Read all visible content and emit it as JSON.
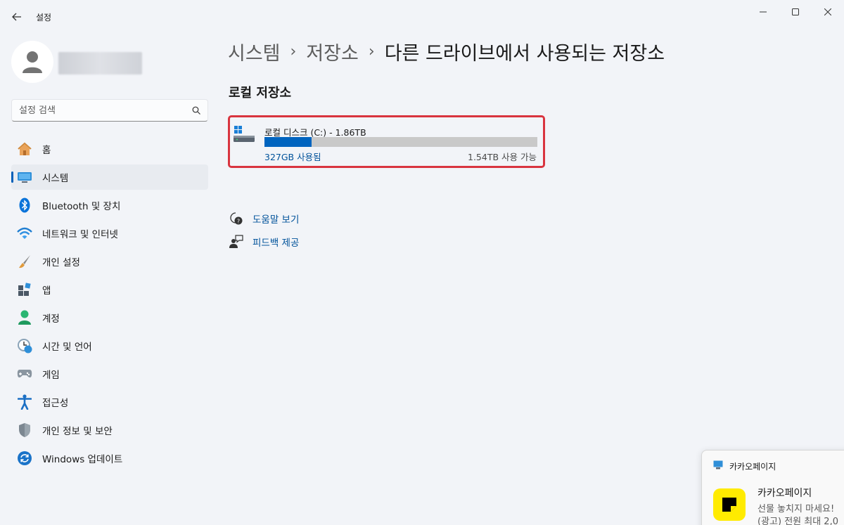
{
  "window": {
    "app_title": "설정"
  },
  "sidebar": {
    "search_placeholder": "설정 검색",
    "items": [
      {
        "label": "홈",
        "icon": "home-icon"
      },
      {
        "label": "시스템",
        "icon": "system-icon",
        "selected": true
      },
      {
        "label": "Bluetooth 및 장치",
        "icon": "bluetooth-icon"
      },
      {
        "label": "네트워크 및 인터넷",
        "icon": "wifi-icon"
      },
      {
        "label": "개인 설정",
        "icon": "brush-icon"
      },
      {
        "label": "앱",
        "icon": "apps-icon"
      },
      {
        "label": "계정",
        "icon": "account-icon"
      },
      {
        "label": "시간 및 언어",
        "icon": "time-language-icon"
      },
      {
        "label": "게임",
        "icon": "gamepad-icon"
      },
      {
        "label": "접근성",
        "icon": "accessibility-icon"
      },
      {
        "label": "개인 정보 및 보안",
        "icon": "shield-icon"
      },
      {
        "label": "Windows 업데이트",
        "icon": "update-icon"
      }
    ]
  },
  "main": {
    "breadcrumb": [
      "시스템",
      "저장소",
      "다른 드라이브에서 사용되는 저장소"
    ],
    "section_title": "로컬 저장소",
    "drive": {
      "name": "로컬 디스크 (C:) - 1.86TB",
      "used_label": "327GB 사용됨",
      "free_label": "1.54TB 사용 가능",
      "used_fraction": 0.172
    },
    "help_links": [
      {
        "label": "도움말 보기",
        "icon": "help-icon"
      },
      {
        "label": "피드백 제공",
        "icon": "feedback-icon"
      }
    ]
  },
  "toast": {
    "app_name": "카카오페이지",
    "title": "카카오페이지",
    "line1": "선물 놓치지 마세요!",
    "line2": "(광고) 전원 최대 2,0"
  },
  "colors": {
    "accent": "#005fb8",
    "highlight_border": "#d9343f",
    "usage_fill": "#0064bf"
  }
}
